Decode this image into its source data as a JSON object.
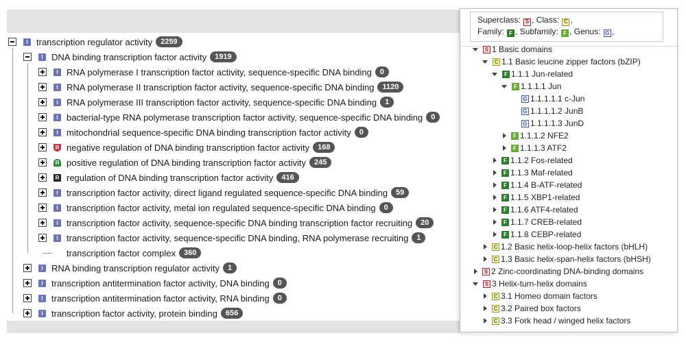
{
  "go_tree": {
    "rows": [
      {
        "depth": 0,
        "toggle": "minus",
        "icon": "i",
        "label": "transcription regulator activity",
        "count": "2259"
      },
      {
        "depth": 1,
        "toggle": "minus",
        "icon": "i",
        "label": "DNA binding transcription factor activity",
        "count": "1919"
      },
      {
        "depth": 2,
        "toggle": "plus",
        "icon": "i",
        "label": "RNA polymerase I transcription factor activity, sequence-specific DNA binding",
        "count": "0"
      },
      {
        "depth": 2,
        "toggle": "plus",
        "icon": "i",
        "label": "RNA polymerase II transcription factor activity, sequence-specific DNA binding",
        "count": "1120"
      },
      {
        "depth": 2,
        "toggle": "plus",
        "icon": "i",
        "label": "RNA polymerase III transcription factor activity, sequence-specific DNA binding",
        "count": "1"
      },
      {
        "depth": 2,
        "toggle": "plus",
        "icon": "i",
        "label": "bacterial-type RNA polymerase transcription factor activity, sequence-specific DNA binding",
        "count": "0"
      },
      {
        "depth": 2,
        "toggle": "plus",
        "icon": "i",
        "label": "mitochondrial sequence-specific DNA binding transcription factor activity",
        "count": "0"
      },
      {
        "depth": 2,
        "toggle": "plus",
        "icon": "neg",
        "label": "negative regulation of DNA binding transcription factor activity",
        "count": "168"
      },
      {
        "depth": 2,
        "toggle": "plus",
        "icon": "pos",
        "label": "positive regulation of DNA binding transcription factor activity",
        "count": "245"
      },
      {
        "depth": 2,
        "toggle": "plus",
        "icon": "r",
        "label": "regulation of DNA binding transcription factor activity",
        "count": "416"
      },
      {
        "depth": 2,
        "toggle": "plus",
        "icon": "i",
        "label": "transcription factor activity, direct ligand regulated sequence-specific DNA binding",
        "count": "59"
      },
      {
        "depth": 2,
        "toggle": "plus",
        "icon": "i",
        "label": "transcription factor activity, metal ion regulated sequence-specific DNA binding",
        "count": "0"
      },
      {
        "depth": 2,
        "toggle": "plus",
        "icon": "i",
        "label": "transcription factor activity, sequence-specific DNA binding transcription factor recruiting",
        "count": "20"
      },
      {
        "depth": 2,
        "toggle": "plus",
        "icon": "i",
        "label": "transcription factor activity, sequence-specific DNA binding, RNA polymerase recruiting",
        "count": "1"
      },
      {
        "depth": 2,
        "toggle": "none",
        "icon": "",
        "label": "transcription factor complex",
        "count": "360"
      },
      {
        "depth": 1,
        "toggle": "plus",
        "icon": "i",
        "label": "RNA binding transcription regulator activity",
        "count": "1"
      },
      {
        "depth": 1,
        "toggle": "plus",
        "icon": "i",
        "label": "transcription antitermination factor activity, DNA binding",
        "count": "0"
      },
      {
        "depth": 1,
        "toggle": "plus",
        "icon": "i",
        "label": "transcription antitermination factor activity, RNA binding",
        "count": "0"
      },
      {
        "depth": 1,
        "toggle": "plus",
        "icon": "i",
        "label": "transcription factor activity, protein binding",
        "count": "656"
      }
    ]
  },
  "legend": {
    "superclass_label": "Superclass:",
    "class_label": ", Class:",
    "class_suffix": ",",
    "family_label": "Family:",
    "subfamily_label": ", Subfamily:",
    "genus_label": ", Genus:",
    "genus_suffix": ",",
    "letters": {
      "superclass": "S",
      "class": "C",
      "family": "F",
      "subfamily": "F",
      "genus": "G"
    }
  },
  "tf_tree": {
    "rows": [
      {
        "depth": 0,
        "arrow": "down",
        "level": "superclass",
        "letter": "S",
        "label": "1 Basic domains"
      },
      {
        "depth": 1,
        "arrow": "down",
        "level": "class",
        "letter": "C",
        "label": "1.1 Basic leucine zipper factors (bZIP)"
      },
      {
        "depth": 2,
        "arrow": "down",
        "level": "family",
        "letter": "F",
        "label": "1.1.1 Jun-related"
      },
      {
        "depth": 3,
        "arrow": "down",
        "level": "subfamily",
        "letter": "F",
        "label": "1.1.1.1 Jun"
      },
      {
        "depth": 4,
        "arrow": "none",
        "level": "genus",
        "letter": "G",
        "label": "1.1.1.1.1 c-Jun"
      },
      {
        "depth": 4,
        "arrow": "none",
        "level": "genus",
        "letter": "G",
        "label": "1.1.1.1.2 JunB"
      },
      {
        "depth": 4,
        "arrow": "none",
        "level": "genus",
        "letter": "G",
        "label": "1.1.1.1.3 JunD"
      },
      {
        "depth": 3,
        "arrow": "right",
        "level": "subfamily",
        "letter": "F",
        "label": "1.1.1.2 NFE2"
      },
      {
        "depth": 3,
        "arrow": "right",
        "level": "subfamily",
        "letter": "F",
        "label": "1.1.1.3 ATF2"
      },
      {
        "depth": 2,
        "arrow": "right",
        "level": "family",
        "letter": "F",
        "label": "1.1.2 Fos-related"
      },
      {
        "depth": 2,
        "arrow": "right",
        "level": "family",
        "letter": "F",
        "label": "1.1.3 Maf-related"
      },
      {
        "depth": 2,
        "arrow": "right",
        "level": "family",
        "letter": "F",
        "label": "1.1.4 B-ATF-related"
      },
      {
        "depth": 2,
        "arrow": "right",
        "level": "family",
        "letter": "F",
        "label": "1.1.5 XBP1-related"
      },
      {
        "depth": 2,
        "arrow": "right",
        "level": "family",
        "letter": "F",
        "label": "1.1.6 ATF4-related"
      },
      {
        "depth": 2,
        "arrow": "right",
        "level": "family",
        "letter": "F",
        "label": "1.1.7 CREB-related"
      },
      {
        "depth": 2,
        "arrow": "right",
        "level": "family",
        "letter": "F",
        "label": "1.1.8 CEBP-related"
      },
      {
        "depth": 1,
        "arrow": "right",
        "level": "class",
        "letter": "C",
        "label": "1.2 Basic helix-loop-helix factors (bHLH)"
      },
      {
        "depth": 1,
        "arrow": "right",
        "level": "class",
        "letter": "C",
        "label": "1.3 Basic helix-span-helix factors (bHSH)"
      },
      {
        "depth": 0,
        "arrow": "right",
        "level": "superclass",
        "letter": "S",
        "label": "2 Zinc-coordinating DNA-binding domains"
      },
      {
        "depth": 0,
        "arrow": "down",
        "level": "superclass",
        "letter": "S",
        "label": "3 Helix-turn-helix domains"
      },
      {
        "depth": 1,
        "arrow": "right",
        "level": "class",
        "letter": "C",
        "label": "3.1 Homeo domain factors"
      },
      {
        "depth": 1,
        "arrow": "right",
        "level": "class",
        "letter": "C",
        "label": "3.2 Paired box factors"
      },
      {
        "depth": 1,
        "arrow": "right",
        "level": "class",
        "letter": "C",
        "label": "3.3 Fork head / winged helix factors"
      }
    ]
  },
  "colors": {
    "badge": "#555555",
    "icon_info": "#6b73b3",
    "icon_negative": "#c0323a",
    "icon_positive": "#2e8b3a",
    "icon_regulation": "#222222",
    "pane_header": "#e4e4e4"
  }
}
